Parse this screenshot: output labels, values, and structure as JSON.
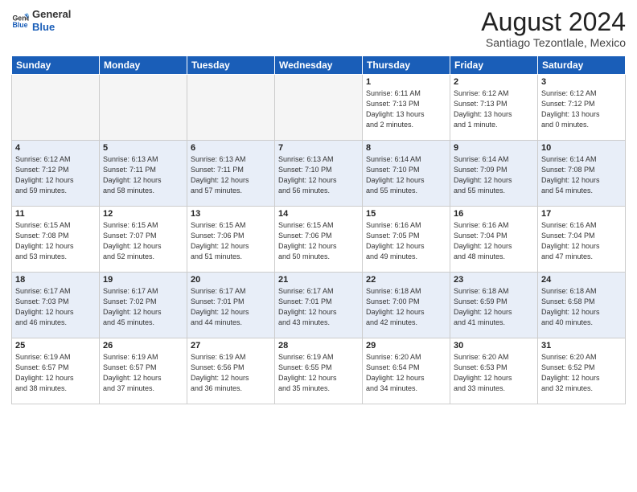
{
  "header": {
    "logo_line1": "General",
    "logo_line2": "Blue",
    "month_year": "August 2024",
    "location": "Santiago Tezontlale, Mexico"
  },
  "days_of_week": [
    "Sunday",
    "Monday",
    "Tuesday",
    "Wednesday",
    "Thursday",
    "Friday",
    "Saturday"
  ],
  "weeks": [
    [
      {
        "day": "",
        "info": ""
      },
      {
        "day": "",
        "info": ""
      },
      {
        "day": "",
        "info": ""
      },
      {
        "day": "",
        "info": ""
      },
      {
        "day": "1",
        "info": "Sunrise: 6:11 AM\nSunset: 7:13 PM\nDaylight: 13 hours\nand 2 minutes."
      },
      {
        "day": "2",
        "info": "Sunrise: 6:12 AM\nSunset: 7:13 PM\nDaylight: 13 hours\nand 1 minute."
      },
      {
        "day": "3",
        "info": "Sunrise: 6:12 AM\nSunset: 7:12 PM\nDaylight: 13 hours\nand 0 minutes."
      }
    ],
    [
      {
        "day": "4",
        "info": "Sunrise: 6:12 AM\nSunset: 7:12 PM\nDaylight: 12 hours\nand 59 minutes."
      },
      {
        "day": "5",
        "info": "Sunrise: 6:13 AM\nSunset: 7:11 PM\nDaylight: 12 hours\nand 58 minutes."
      },
      {
        "day": "6",
        "info": "Sunrise: 6:13 AM\nSunset: 7:11 PM\nDaylight: 12 hours\nand 57 minutes."
      },
      {
        "day": "7",
        "info": "Sunrise: 6:13 AM\nSunset: 7:10 PM\nDaylight: 12 hours\nand 56 minutes."
      },
      {
        "day": "8",
        "info": "Sunrise: 6:14 AM\nSunset: 7:10 PM\nDaylight: 12 hours\nand 55 minutes."
      },
      {
        "day": "9",
        "info": "Sunrise: 6:14 AM\nSunset: 7:09 PM\nDaylight: 12 hours\nand 55 minutes."
      },
      {
        "day": "10",
        "info": "Sunrise: 6:14 AM\nSunset: 7:08 PM\nDaylight: 12 hours\nand 54 minutes."
      }
    ],
    [
      {
        "day": "11",
        "info": "Sunrise: 6:15 AM\nSunset: 7:08 PM\nDaylight: 12 hours\nand 53 minutes."
      },
      {
        "day": "12",
        "info": "Sunrise: 6:15 AM\nSunset: 7:07 PM\nDaylight: 12 hours\nand 52 minutes."
      },
      {
        "day": "13",
        "info": "Sunrise: 6:15 AM\nSunset: 7:06 PM\nDaylight: 12 hours\nand 51 minutes."
      },
      {
        "day": "14",
        "info": "Sunrise: 6:15 AM\nSunset: 7:06 PM\nDaylight: 12 hours\nand 50 minutes."
      },
      {
        "day": "15",
        "info": "Sunrise: 6:16 AM\nSunset: 7:05 PM\nDaylight: 12 hours\nand 49 minutes."
      },
      {
        "day": "16",
        "info": "Sunrise: 6:16 AM\nSunset: 7:04 PM\nDaylight: 12 hours\nand 48 minutes."
      },
      {
        "day": "17",
        "info": "Sunrise: 6:16 AM\nSunset: 7:04 PM\nDaylight: 12 hours\nand 47 minutes."
      }
    ],
    [
      {
        "day": "18",
        "info": "Sunrise: 6:17 AM\nSunset: 7:03 PM\nDaylight: 12 hours\nand 46 minutes."
      },
      {
        "day": "19",
        "info": "Sunrise: 6:17 AM\nSunset: 7:02 PM\nDaylight: 12 hours\nand 45 minutes."
      },
      {
        "day": "20",
        "info": "Sunrise: 6:17 AM\nSunset: 7:01 PM\nDaylight: 12 hours\nand 44 minutes."
      },
      {
        "day": "21",
        "info": "Sunrise: 6:17 AM\nSunset: 7:01 PM\nDaylight: 12 hours\nand 43 minutes."
      },
      {
        "day": "22",
        "info": "Sunrise: 6:18 AM\nSunset: 7:00 PM\nDaylight: 12 hours\nand 42 minutes."
      },
      {
        "day": "23",
        "info": "Sunrise: 6:18 AM\nSunset: 6:59 PM\nDaylight: 12 hours\nand 41 minutes."
      },
      {
        "day": "24",
        "info": "Sunrise: 6:18 AM\nSunset: 6:58 PM\nDaylight: 12 hours\nand 40 minutes."
      }
    ],
    [
      {
        "day": "25",
        "info": "Sunrise: 6:19 AM\nSunset: 6:57 PM\nDaylight: 12 hours\nand 38 minutes."
      },
      {
        "day": "26",
        "info": "Sunrise: 6:19 AM\nSunset: 6:57 PM\nDaylight: 12 hours\nand 37 minutes."
      },
      {
        "day": "27",
        "info": "Sunrise: 6:19 AM\nSunset: 6:56 PM\nDaylight: 12 hours\nand 36 minutes."
      },
      {
        "day": "28",
        "info": "Sunrise: 6:19 AM\nSunset: 6:55 PM\nDaylight: 12 hours\nand 35 minutes."
      },
      {
        "day": "29",
        "info": "Sunrise: 6:20 AM\nSunset: 6:54 PM\nDaylight: 12 hours\nand 34 minutes."
      },
      {
        "day": "30",
        "info": "Sunrise: 6:20 AM\nSunset: 6:53 PM\nDaylight: 12 hours\nand 33 minutes."
      },
      {
        "day": "31",
        "info": "Sunrise: 6:20 AM\nSunset: 6:52 PM\nDaylight: 12 hours\nand 32 minutes."
      }
    ]
  ]
}
